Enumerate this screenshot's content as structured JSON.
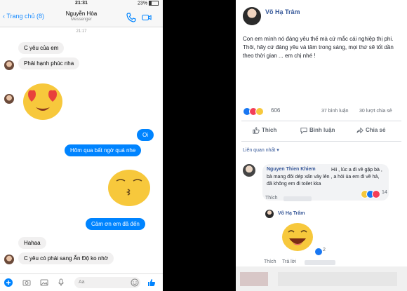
{
  "messenger": {
    "status_bar": {
      "time": "21:31",
      "battery": "23%"
    },
    "header": {
      "back_label": "Trang chủ (8)",
      "contact_name": "Nguyễn Hòa",
      "contact_sub": "Messenger"
    },
    "timestamp": "21:17",
    "messages": [
      {
        "text": "C yêu của em"
      },
      {
        "text": "Phải hạnh phúc nha"
      },
      {
        "text": "Oi"
      },
      {
        "text": "Hôm qua bất ngờ quá nhe"
      },
      {
        "text": "Cảm ơn em đã đến"
      },
      {
        "text": "Hahaa"
      },
      {
        "text": "C yêu có phải sang Ấn Độ ko nhờ"
      }
    ],
    "composer": {
      "placeholder": "Aa"
    }
  },
  "facebook": {
    "author": "Võ Hạ Trâm",
    "post_text": "Con em mình nó đáng yêu thế mà cứ mắc cái nghiệp thị phi. Thôi, hãy cứ đáng yêu và tâm trong sáng, mọi thứ sẽ tốt dần theo thời gian ... em chị nhé !",
    "reaction_count": "606",
    "comment_count": "37 bình luận",
    "share_count": "30 lượt chia sẻ",
    "actions": {
      "like": "Thích",
      "comment": "Bình luận",
      "share": "Chia sẻ"
    },
    "comment_filter": "Liên quan nhất ▾",
    "comments": [
      {
        "author": "Nguyen Thien Khiem",
        "text": "Hii , lúc a đi về gặp bà , bà mang đôi dép xấn vảy lên , a hỏi ủa em đi về hả, đã không em đi toilet kka",
        "like_label": "Thích",
        "reaction_count": "14"
      },
      {
        "author": "Võ Hạ Trâm",
        "reaction_count": "2",
        "like_label": "Thích",
        "reply_label": "Trả lời"
      }
    ]
  },
  "colors": {
    "messenger_blue": "#0084ff",
    "incoming_bubble": "#f1f0f0",
    "facebook_link": "#365899",
    "emoji_yellow": "#f7c83c"
  }
}
